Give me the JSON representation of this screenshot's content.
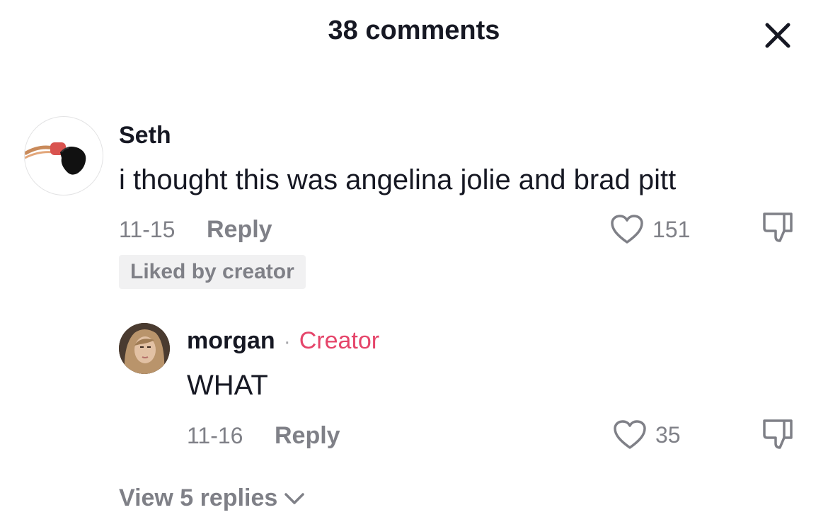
{
  "header": {
    "title": "38 comments"
  },
  "icons": {
    "close": "close-icon",
    "heart": "heart-outline-icon",
    "dislike": "thumbs-down-icon",
    "chevron": "chevron-down-icon"
  },
  "colors": {
    "creator_tag": "#e5456a",
    "secondary_text": "#7f8087"
  },
  "comments": [
    {
      "username": "Seth",
      "text": "i thought this was angelina jolie and brad pitt",
      "date": "11-15",
      "reply_label": "Reply",
      "likes": "151",
      "badge": "Liked by creator"
    }
  ],
  "reply": {
    "username": "morgan",
    "separator": "·",
    "tag": "Creator",
    "text": "WHAT",
    "date": "11-16",
    "reply_label": "Reply",
    "likes": "35"
  },
  "view_replies": {
    "label": "View 5 replies"
  }
}
